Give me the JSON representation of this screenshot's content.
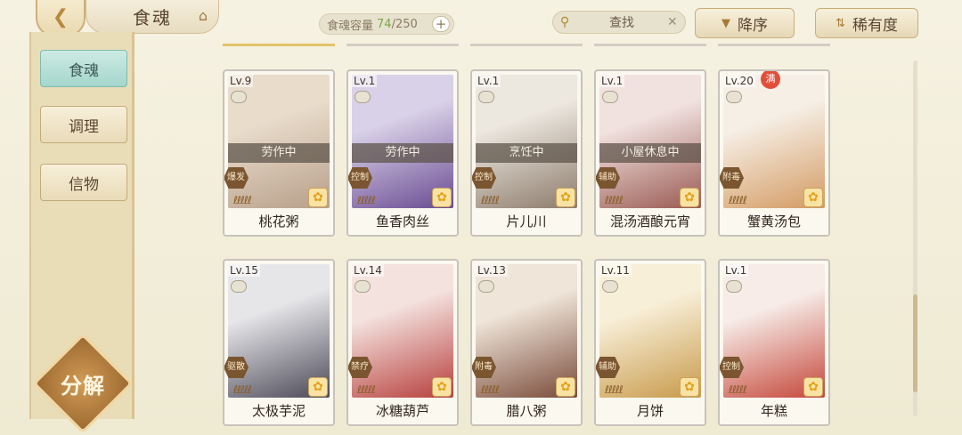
{
  "header": {
    "back_icon": "back-arrow-icon",
    "title": "食魂",
    "home_icon": "home-icon",
    "capacity_label": "食魂容量",
    "capacity_current": "74",
    "capacity_total": "/250",
    "capacity_add": "+",
    "search_placeholder": "查找",
    "search_clear": "✕",
    "sort_order_label": "降序",
    "sort_rarity_label": "稀有度"
  },
  "sidebar": {
    "tabs": [
      {
        "label": "食魂",
        "active": true
      },
      {
        "label": "调理",
        "active": false
      },
      {
        "label": "信物",
        "active": false
      }
    ],
    "decompose_label": "分解"
  },
  "cards": [
    {
      "level": "Lv.9",
      "name": "桃花粥",
      "status": "劳作中",
      "role": "爆发",
      "art": [
        "#e9dccb",
        "#b79f8a"
      ]
    },
    {
      "level": "Lv.1",
      "name": "鱼香肉丝",
      "status": "劳作中",
      "role": "控制",
      "art": [
        "#d9d1e8",
        "#6a4c92"
      ]
    },
    {
      "level": "Lv.1",
      "name": "片儿川",
      "status": "烹饪中",
      "role": "控制",
      "art": [
        "#ece7df",
        "#8d7c6d"
      ]
    },
    {
      "level": "Lv.1",
      "name": "混汤酒酿元宵",
      "status": "小屋休息中",
      "role": "辅助",
      "art": [
        "#f1e2e0",
        "#9a5a52"
      ]
    },
    {
      "level": "Lv.20",
      "name": "蟹黄汤包",
      "status": "",
      "role": "附毒",
      "full": "满",
      "art": [
        "#f6efe6",
        "#d49b63"
      ]
    },
    {
      "level": "Lv.15",
      "name": "太极芋泥",
      "status": "",
      "role": "驱散",
      "art": [
        "#e6e6e9",
        "#4d4a58"
      ]
    },
    {
      "level": "Lv.14",
      "name": "冰糖葫芦",
      "status": "",
      "role": "禁疗",
      "art": [
        "#f4e2df",
        "#b73f3c"
      ]
    },
    {
      "level": "Lv.13",
      "name": "腊八粥",
      "status": "",
      "role": "附毒",
      "art": [
        "#efe5d9",
        "#7a4b3a"
      ]
    },
    {
      "level": "Lv.11",
      "name": "月饼",
      "status": "",
      "role": "辅助",
      "art": [
        "#f8efd8",
        "#c89a4b"
      ]
    },
    {
      "level": "Lv.1",
      "name": "年糕",
      "status": "",
      "role": "控制",
      "art": [
        "#f7ece8",
        "#c5473a"
      ]
    }
  ],
  "stars": "ℓℓℓℓℓ",
  "colors": {
    "accent": "#a87a35",
    "active_tab": "#a5d6cc",
    "capacity_current": "#7aa64a"
  }
}
